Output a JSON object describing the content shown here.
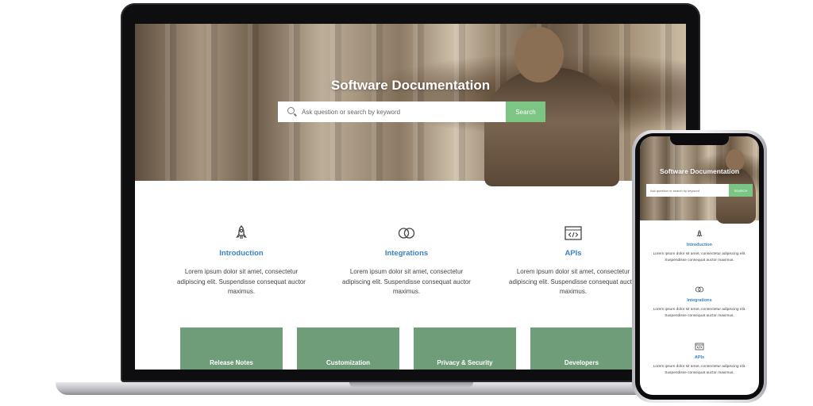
{
  "site": {
    "hero_title": "Software Documentation",
    "search_placeholder": "Ask question or search by keyword",
    "search_button_desktop": "Search",
    "search_button_mobile": "SEARCH"
  },
  "features": [
    {
      "icon": "rocket-icon",
      "title": "Introduction",
      "description": "Lorem ipsum dolor sit amet, consectetur adipiscing elit. Suspendisse consequat auctor maximus."
    },
    {
      "icon": "rings-icon",
      "title": "Integrations",
      "description": "Lorem ipsum dolor sit amet, consectetur adipiscing elit. Suspendisse consequat auctor maximus."
    },
    {
      "icon": "code-window-icon",
      "title": "APIs",
      "description": "Lorem ipsum dolor sit amet, consectetur adipiscing elit. Suspendisse consequat auctor maximus."
    }
  ],
  "tiles": [
    "Release Notes",
    "Customization",
    "Privacy & Security",
    "Developers"
  ],
  "colors": {
    "accent_green": "#7cc585",
    "tile_green": "#6f9d7a",
    "link_blue": "#3b82c4"
  }
}
